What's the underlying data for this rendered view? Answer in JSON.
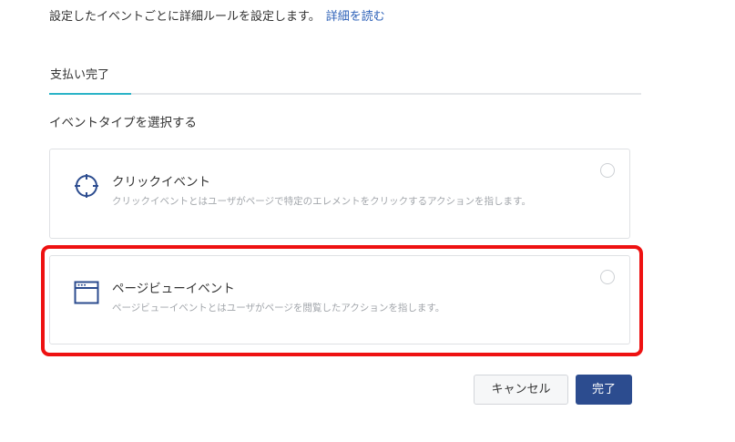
{
  "intro": {
    "text": "設定したイベントごとに詳細ルールを設定します。",
    "link": "詳細を読む"
  },
  "tabs": [
    {
      "label": "支払い完了",
      "active": true
    }
  ],
  "section_label": "イベントタイプを選択する",
  "event_types": [
    {
      "title": "クリックイベント",
      "description": "クリックイベントとはユーザがページで特定のエレメントをクリックするアクションを指します。",
      "icon": "crosshair-icon",
      "selected": false
    },
    {
      "title": "ページビューイベント",
      "description": "ページビューイベントとはユーザがページを閲覧したアクションを指します。",
      "icon": "browser-window-icon",
      "selected": false,
      "highlighted": true
    }
  ],
  "buttons": {
    "cancel": "キャンセル",
    "done": "完了"
  },
  "colors": {
    "link": "#2e62b8",
    "tab_underline": "#2bb4c8",
    "primary_button": "#2c4c8f",
    "icon": "#2c4c8f",
    "highlight": "#ee1111"
  }
}
